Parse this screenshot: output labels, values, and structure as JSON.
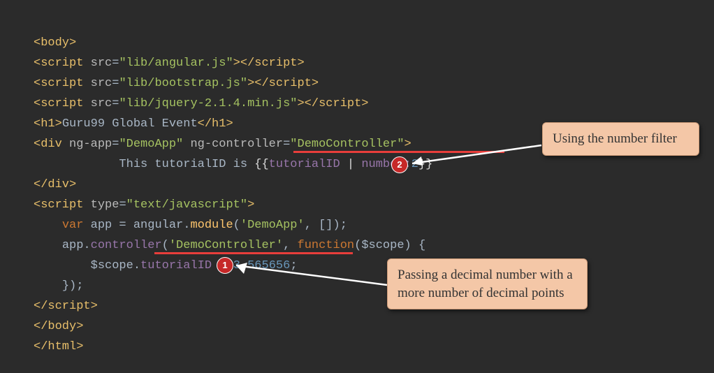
{
  "code": {
    "line1": {
      "tag_o": "<body>"
    },
    "line2": {
      "tag_o": "<script",
      "attr1": "src",
      "eq": "=",
      "str1": "\"lib/angular.js\"",
      "tag_c": "></script>"
    },
    "line3": {
      "tag_o": "<script",
      "attr1": "src",
      "eq": "=",
      "str1": "\"lib/bootstrap.js\"",
      "tag_c": "></script>"
    },
    "line4": {
      "tag_o": "<script",
      "attr1": "src",
      "eq": "=",
      "str1": "\"lib/jquery-2.1.4.min.js\"",
      "tag_c": "></script>"
    },
    "line5": {
      "tag_o": "<h1>",
      "text": "Guru99 Global Event",
      "tag_c": "</h1>"
    },
    "line6": {
      "tag_o": "<div",
      "attr1": "ng-app",
      "eq1": "=",
      "str1": "\"DemoApp\"",
      "attr2": "ng-controller",
      "eq2": "=",
      "str2": "\"DemoController\"",
      "tag_c": ">"
    },
    "line7": {
      "indent": "            ",
      "text1": "This tutorialID is ",
      "dl": "{{",
      "expr": "tutorialID",
      "pipe": " | ",
      "filt": "number:",
      "num": "2",
      "dr": "}}"
    },
    "line8": {
      "tag": "</div>"
    },
    "line9": {
      "tag_o": "<script",
      "attr1": "type",
      "eq": "=",
      "str1": "\"text/javascript\"",
      "tag_c": ">"
    },
    "line10": {
      "indent": "    ",
      "kw": "var",
      "sp": " ",
      "id": "app = angular.",
      "fn": "module",
      "open": "(",
      "str": "'DemoApp'",
      "rest": ", []);"
    },
    "line11": {
      "indent": "    ",
      "id": "app.",
      "prop": "controller",
      "open": "(",
      "str": "'DemoController'",
      "comma": ", ",
      "kw": "function",
      "args": "($scope) {"
    },
    "line12": {
      "indent": "        ",
      "scope": "$scope.",
      "prop": "tutorialID",
      "eq": " = ",
      "num": "3.565656",
      "semi": ";"
    },
    "line13": {
      "indent": "    ",
      "close": "});"
    },
    "line14": {
      "tag": "</script>"
    },
    "line15": {
      "tag": "</body>"
    },
    "line16": {
      "tag": "</html>"
    }
  },
  "underlines": {
    "u1": "",
    "u2": ""
  },
  "badges": {
    "b1": "1",
    "b2": "2"
  },
  "callouts": {
    "c1": "Using the number filter",
    "c2": "Passing a decimal number with a more number of decimal points"
  }
}
